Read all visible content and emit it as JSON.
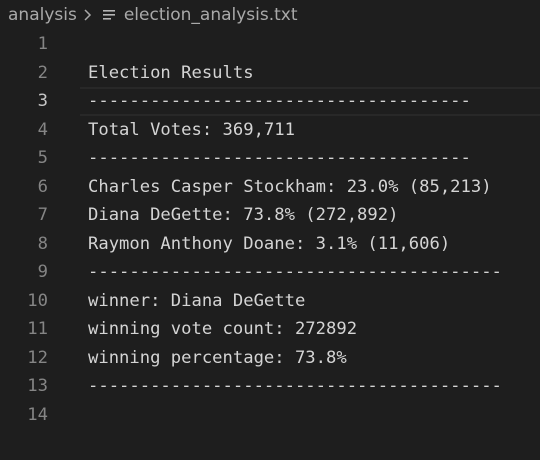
{
  "breadcrumb": {
    "folder": "analysis",
    "separator_icon": "chevron-right-icon",
    "file_icon": "text-file-lines-icon",
    "file": "election_analysis.txt"
  },
  "editor": {
    "current_line": 3,
    "lines": [
      {
        "number": "1",
        "text": ""
      },
      {
        "number": "2",
        "text": "Election Results"
      },
      {
        "number": "3",
        "text": "-------------------------------------"
      },
      {
        "number": "4",
        "text": "Total Votes: 369,711"
      },
      {
        "number": "5",
        "text": "-------------------------------------"
      },
      {
        "number": "6",
        "text": "Charles Casper Stockham: 23.0% (85,213)"
      },
      {
        "number": "7",
        "text": "Diana DeGette: 73.8% (272,892)"
      },
      {
        "number": "8",
        "text": "Raymon Anthony Doane: 3.1% (11,606)"
      },
      {
        "number": "9",
        "text": "----------------------------------------"
      },
      {
        "number": "10",
        "text": "winner: Diana DeGette"
      },
      {
        "number": "11",
        "text": "winning vote count: 272892"
      },
      {
        "number": "12",
        "text": "winning percentage: 73.8%"
      },
      {
        "number": "13",
        "text": "----------------------------------------"
      },
      {
        "number": "14",
        "text": ""
      }
    ]
  }
}
